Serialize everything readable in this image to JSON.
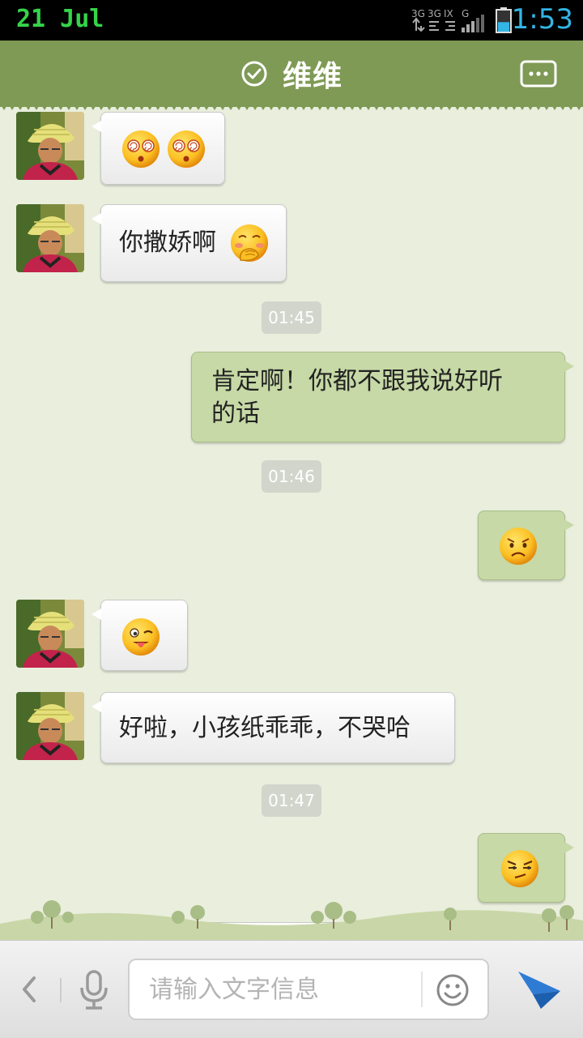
{
  "status_bar": {
    "date": "21  Jul",
    "time": "1:53",
    "network_labels": [
      "3G",
      "3G",
      "IX",
      "G"
    ],
    "battery_level": 0.45,
    "clock_color": "#33b5e5",
    "date_color": "#35d44a"
  },
  "header": {
    "title": "维维",
    "verified_icon": "check-circle-icon",
    "more_icon": "more-dots-icon",
    "color": "#7f9a55"
  },
  "messages": [
    {
      "side": "in",
      "text": "",
      "emojis": [
        "dizzy-face-icon",
        "dizzy-face-icon"
      ]
    },
    {
      "side": "in",
      "text": "你撒娇啊",
      "emojis": [
        "shy-face-icon"
      ]
    },
    {
      "type": "time",
      "text": "01:45"
    },
    {
      "side": "out",
      "text": "肯定啊！你都不跟我说好听的话",
      "emojis": []
    },
    {
      "type": "time",
      "text": "01:46"
    },
    {
      "side": "out",
      "text": "",
      "emojis": [
        "sad-face-icon"
      ]
    },
    {
      "side": "in",
      "text": "",
      "emojis": [
        "tongue-wink-face-icon"
      ]
    },
    {
      "side": "in",
      "text": "好啦，小孩纸乖乖，不哭哈",
      "emojis": []
    },
    {
      "type": "time",
      "text": "01:47"
    },
    {
      "side": "out",
      "text": "",
      "emojis": [
        "smirk-face-icon"
      ]
    }
  ],
  "chat": {
    "msg1": {
      "emojis": [
        "dizzy-face-icon",
        "dizzy-face-icon"
      ]
    },
    "msg2": {
      "text": "你撒娇啊"
    },
    "time1": "01:45",
    "msg3": {
      "line1": "肯定啊！你都不跟我说好听",
      "line2": "的话"
    },
    "time2": "01:46",
    "msg6": {
      "text": "好啦，小孩纸乖乖，不哭哈"
    },
    "time3": "01:47"
  },
  "input_bar": {
    "placeholder": "请输入文字信息",
    "value": "",
    "back_icon": "chevron-left-icon",
    "mic_icon": "microphone-icon",
    "emoji_icon": "smiley-icon",
    "send_icon": "send-icon"
  },
  "colors": {
    "background": "#e9eedd",
    "outgoing_bubble": "#c6d9a6",
    "incoming_bubble": "#ffffff",
    "timestamp_bg": "#d2d5cc",
    "send_icon": "#2f7bd4"
  }
}
